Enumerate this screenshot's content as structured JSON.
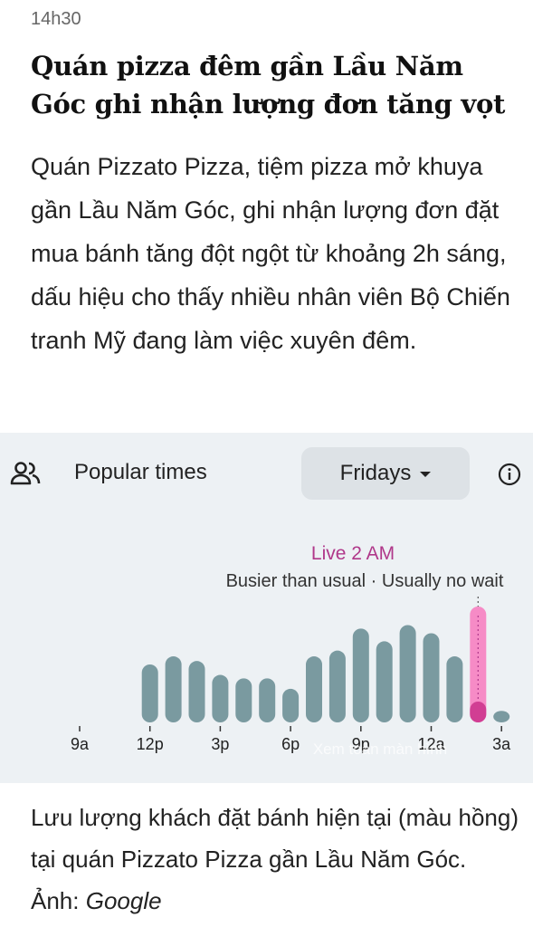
{
  "article": {
    "time": "14h30",
    "headline": "Quán pizza đêm gần Lầu Năm Góc ghi nhận lượng đơn tăng vọt",
    "lede": "Quán Pizzato Pizza, tiệm pizza mở khuya gần Lầu Năm Góc, ghi nhận lượng đơn đặt mua bánh tăng đột ngột từ khoảng 2h sáng, dấu hiệu cho thấy nhiều nhân viên Bộ Chiến tranh Mỹ đang làm việc xuyên đêm."
  },
  "popular_times": {
    "icon": "people-icon",
    "title": "Popular times",
    "day": "Fridays",
    "info_icon": "info-icon",
    "live_label": "Live 2 AM",
    "status": "Busier than usual · Usually no wait",
    "watermark": "Xem toàn màn hình"
  },
  "chart_data": {
    "type": "bar",
    "title": "",
    "xlabel": "",
    "ylabel": "",
    "ylim": [
      0,
      100
    ],
    "x_tick_labels": [
      "9a",
      "12p",
      "3p",
      "6p",
      "9p",
      "12a",
      "3a"
    ],
    "hours": [
      "9a",
      "10a",
      "11a",
      "12p",
      "1p",
      "2p",
      "3p",
      "4p",
      "5p",
      "6p",
      "7p",
      "8p",
      "9p",
      "10p",
      "11p",
      "12a",
      "1a",
      "2a",
      "3a"
    ],
    "values": [
      0,
      0,
      0,
      50,
      57,
      53,
      41,
      38,
      38,
      29,
      57,
      62,
      81,
      70,
      84,
      77,
      57,
      29,
      10
    ],
    "live": {
      "hour": "2a",
      "usual": 18,
      "live": 100
    },
    "colors": {
      "bar": "#7a9aa0",
      "live": "#f68bc6",
      "live_usual": "#d13e93"
    },
    "grid": false,
    "legend": "none"
  },
  "caption": {
    "text": "Lưu lượng khách đặt bánh hiện tại (màu hồng) tại quán Pizzato Pizza gần Lầu Năm Góc. Ảnh: ",
    "source": "Google"
  }
}
